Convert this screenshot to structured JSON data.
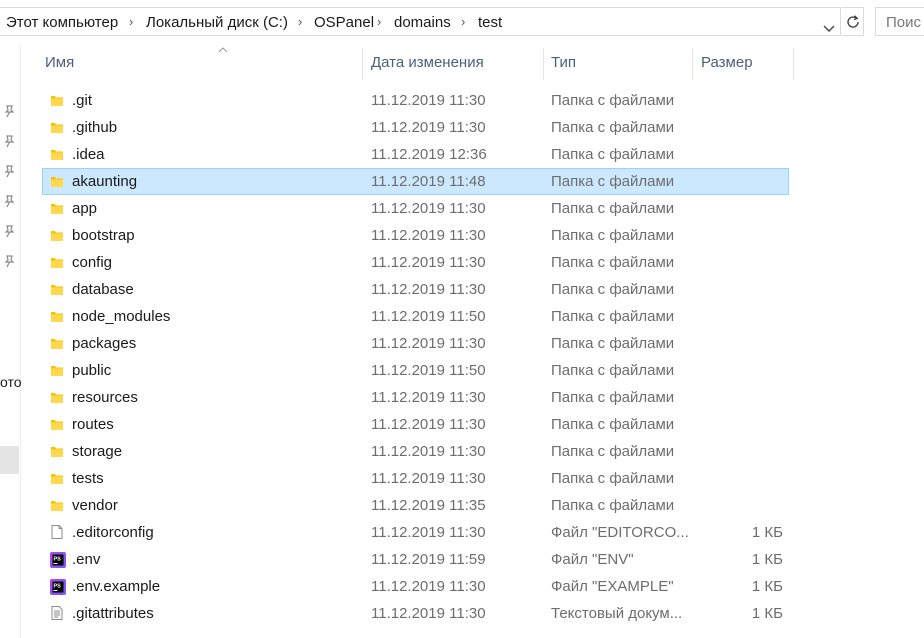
{
  "breadcrumb": {
    "items": [
      "Этот компьютер",
      "Локальный диск (C:)",
      "OSPanel",
      "domains",
      "test"
    ],
    "separator": "›"
  },
  "search": {
    "placeholder": "Поис"
  },
  "nav": {
    "partial_label": "ото"
  },
  "columns": {
    "name": "Имя",
    "date": "Дата изменения",
    "type": "Тип",
    "size": "Размер"
  },
  "colors": {
    "selection_bg": "#cce8ff",
    "selection_border": "#99d1ff",
    "folder": "#f5c400",
    "header_text": "#4c607a"
  },
  "files": [
    {
      "name": ".git",
      "date": "11.12.2019 11:30",
      "type": "Папка с файлами",
      "size": "",
      "icon": "folder-icon",
      "selected": false
    },
    {
      "name": ".github",
      "date": "11.12.2019 11:30",
      "type": "Папка с файлами",
      "size": "",
      "icon": "folder-icon",
      "selected": false
    },
    {
      "name": ".idea",
      "date": "11.12.2019 12:36",
      "type": "Папка с файлами",
      "size": "",
      "icon": "folder-icon",
      "selected": false
    },
    {
      "name": "akaunting",
      "date": "11.12.2019 11:48",
      "type": "Папка с файлами",
      "size": "",
      "icon": "folder-icon",
      "selected": true
    },
    {
      "name": "app",
      "date": "11.12.2019 11:30",
      "type": "Папка с файлами",
      "size": "",
      "icon": "folder-icon",
      "selected": false
    },
    {
      "name": "bootstrap",
      "date": "11.12.2019 11:30",
      "type": "Папка с файлами",
      "size": "",
      "icon": "folder-icon",
      "selected": false
    },
    {
      "name": "config",
      "date": "11.12.2019 11:30",
      "type": "Папка с файлами",
      "size": "",
      "icon": "folder-icon",
      "selected": false
    },
    {
      "name": "database",
      "date": "11.12.2019 11:30",
      "type": "Папка с файлами",
      "size": "",
      "icon": "folder-icon",
      "selected": false
    },
    {
      "name": "node_modules",
      "date": "11.12.2019 11:50",
      "type": "Папка с файлами",
      "size": "",
      "icon": "folder-icon",
      "selected": false
    },
    {
      "name": "packages",
      "date": "11.12.2019 11:30",
      "type": "Папка с файлами",
      "size": "",
      "icon": "folder-icon",
      "selected": false
    },
    {
      "name": "public",
      "date": "11.12.2019 11:50",
      "type": "Папка с файлами",
      "size": "",
      "icon": "folder-icon",
      "selected": false
    },
    {
      "name": "resources",
      "date": "11.12.2019 11:30",
      "type": "Папка с файлами",
      "size": "",
      "icon": "folder-icon",
      "selected": false
    },
    {
      "name": "routes",
      "date": "11.12.2019 11:30",
      "type": "Папка с файлами",
      "size": "",
      "icon": "folder-icon",
      "selected": false
    },
    {
      "name": "storage",
      "date": "11.12.2019 11:30",
      "type": "Папка с файлами",
      "size": "",
      "icon": "folder-icon",
      "selected": false
    },
    {
      "name": "tests",
      "date": "11.12.2019 11:30",
      "type": "Папка с файлами",
      "size": "",
      "icon": "folder-icon",
      "selected": false
    },
    {
      "name": "vendor",
      "date": "11.12.2019 11:35",
      "type": "Папка с файлами",
      "size": "",
      "icon": "folder-icon",
      "selected": false
    },
    {
      "name": ".editorconfig",
      "date": "11.12.2019 11:30",
      "type": "Файл \"EDITORCO...",
      "size": "1 КБ",
      "icon": "file-icon",
      "selected": false
    },
    {
      "name": ".env",
      "date": "11.12.2019 11:59",
      "type": "Файл \"ENV\"",
      "size": "1 КБ",
      "icon": "phpstorm-icon",
      "selected": false
    },
    {
      "name": ".env.example",
      "date": "11.12.2019 11:30",
      "type": "Файл \"EXAMPLE\"",
      "size": "1 КБ",
      "icon": "phpstorm-icon",
      "selected": false
    },
    {
      "name": ".gitattributes",
      "date": "11.12.2019 11:30",
      "type": "Текстовый докум...",
      "size": "1 КБ",
      "icon": "text-file-icon",
      "selected": false
    }
  ]
}
